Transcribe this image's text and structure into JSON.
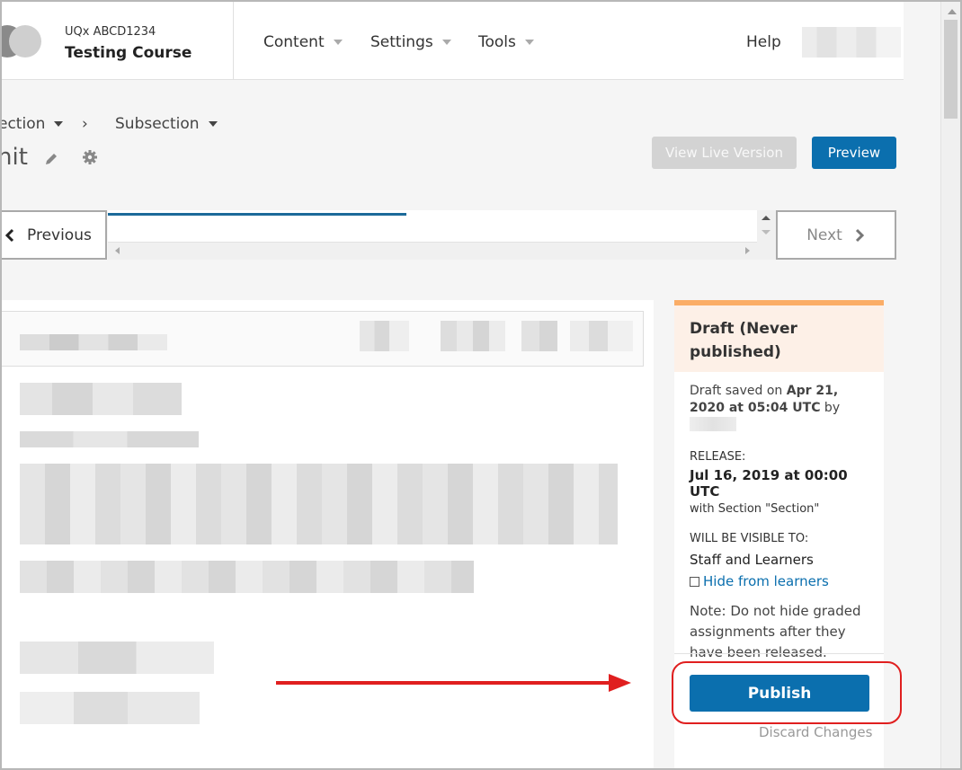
{
  "header": {
    "course_org": "UQx  ABCD1234",
    "course_title": "Testing Course",
    "nav": [
      {
        "label": "Content"
      },
      {
        "label": "Settings"
      },
      {
        "label": "Tools"
      }
    ],
    "help_label": "Help"
  },
  "breadcrumb": {
    "section_label": "ection",
    "separator": "›",
    "subsection_label": "Subsection"
  },
  "unit": {
    "title": "nit"
  },
  "actions": {
    "view_live_label": "View Live Version",
    "preview_label": "Preview"
  },
  "sequence_nav": {
    "previous_label": "Previous",
    "next_label": "Next",
    "progress_fraction": 0.46
  },
  "sidebar": {
    "status_title": "Draft (Never published)",
    "draft_saved_prefix": "Draft saved on ",
    "draft_saved_date": "Apr 21, 2020 at 05:04 UTC",
    "draft_saved_by": " by",
    "release_label": "RELEASE:",
    "release_date": "Jul 16, 2019 at 00:00 UTC",
    "release_with": "with Section \"Section\"",
    "visible_label": "WILL BE VISIBLE TO:",
    "visible_value": "Staff and Learners",
    "hide_label": "Hide from learners",
    "note": "Note: Do not hide graded assignments after they have been released.",
    "publish_label": "Publish",
    "discard_label": "Discard Changes"
  },
  "colors": {
    "primary": "#0b6fae",
    "draft_accent": "#fbad66",
    "draft_bg": "#fdf0e7",
    "annotation_red": "#e01f1f"
  }
}
